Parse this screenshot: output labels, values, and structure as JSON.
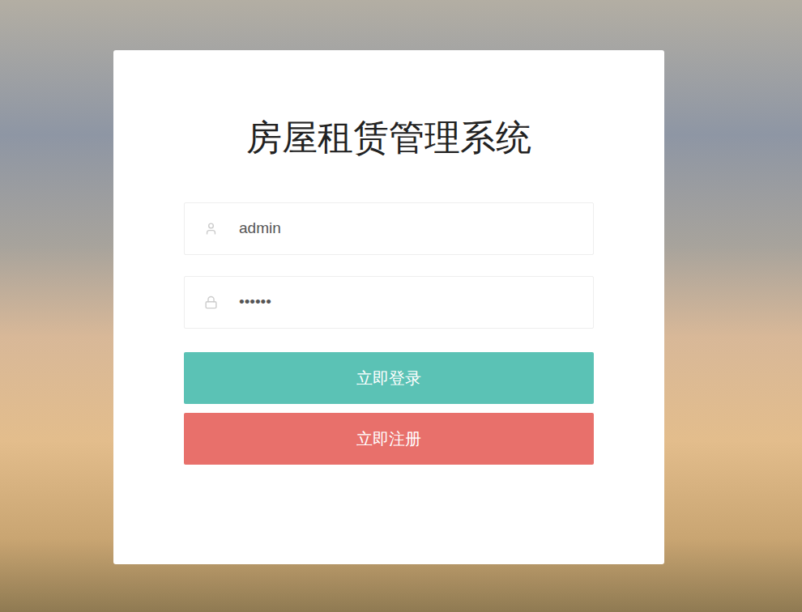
{
  "page": {
    "title": "房屋租赁管理系统"
  },
  "fields": [
    {
      "kind": "user",
      "value": "admin"
    },
    {
      "kind": "password",
      "value": "••••••"
    }
  ],
  "buttons": [
    {
      "label": "立即登录",
      "color": "#5bc2b5"
    },
    {
      "label": "立即注册",
      "color": "#e8706b"
    }
  ]
}
